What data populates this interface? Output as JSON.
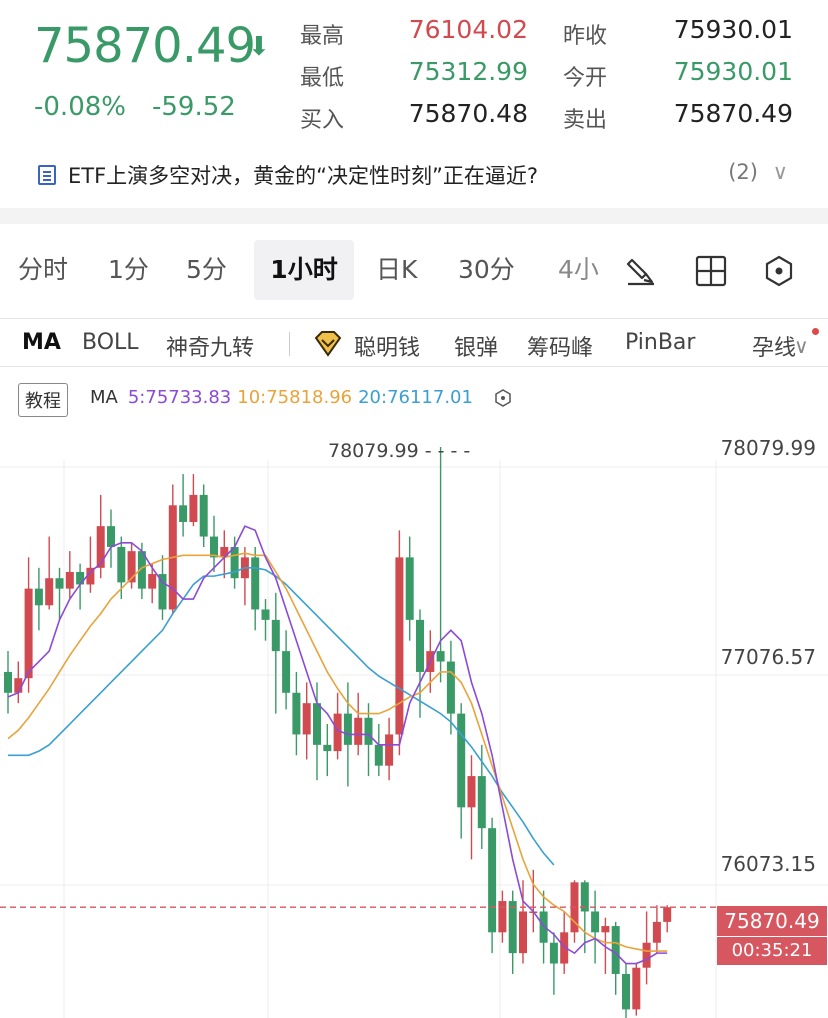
{
  "quote": {
    "price": "75870.49",
    "change_pct": "-0.08%",
    "change": "-59.52",
    "rows": [
      {
        "label": "最高",
        "value": "76104.02",
        "label2": "昨收",
        "value2": "75930.01"
      },
      {
        "label": "最低",
        "value": "75312.99",
        "label2": "今开",
        "value2": "75930.01"
      },
      {
        "label": "买入",
        "value": "75870.48",
        "label2": "卖出",
        "value2": "75870.49"
      }
    ]
  },
  "news": {
    "headline": "ETF上演多空对决，黄金的“决定性时刻”正在逼近?",
    "count": "(2)"
  },
  "timeframes": [
    "分时",
    "1分",
    "5分",
    "1小时",
    "日K",
    "30分",
    "4小"
  ],
  "active_timeframe": "1小时",
  "indicators": [
    "MA",
    "BOLL",
    "神奇九转",
    "聪明钱",
    "银弹",
    "筹码峰",
    "PinBar",
    "孕线"
  ],
  "active_indicator": "MA",
  "chart_header": {
    "tutorial": "教程",
    "ma_label": "MA",
    "ma5": "5:75733.83",
    "ma10": "10:75818.96",
    "ma20": "20:76117.01"
  },
  "colors": {
    "up": "#d04a50",
    "down": "#3a9a67",
    "ma5": "#8a4bd6",
    "ma10": "#e9a33b",
    "ma20": "#3b9fd1"
  },
  "chart_data": {
    "type": "candlestick",
    "price_labels": [
      "78079.99",
      "77076.57",
      "76073.15"
    ],
    "high_marker": "78079.99",
    "current_price": "75870.49",
    "countdown": "00:35:21",
    "candles": [
      [
        77000,
        76900,
        77100,
        76800
      ],
      [
        76900,
        76970,
        77050,
        76850
      ],
      [
        76970,
        77400,
        77550,
        76900
      ],
      [
        77400,
        77320,
        77500,
        77200
      ],
      [
        77320,
        77450,
        77650,
        77300
      ],
      [
        77450,
        77400,
        77500,
        77250
      ],
      [
        77400,
        77480,
        77580,
        77350
      ],
      [
        77480,
        77420,
        77520,
        77300
      ],
      [
        77420,
        77500,
        77650,
        77380
      ],
      [
        77500,
        77700,
        77850,
        77450
      ],
      [
        77700,
        77600,
        77780,
        77500
      ],
      [
        77600,
        77430,
        77650,
        77350
      ],
      [
        77430,
        77580,
        77620,
        77400
      ],
      [
        77580,
        77400,
        77620,
        77350
      ],
      [
        77400,
        77470,
        77520,
        77330
      ],
      [
        77470,
        77300,
        77560,
        77250
      ],
      [
        77300,
        77800,
        77900,
        77280
      ],
      [
        77800,
        77720,
        77950,
        77650
      ],
      [
        77720,
        77850,
        77950,
        77700
      ],
      [
        77850,
        77650,
        77900,
        77600
      ],
      [
        77650,
        77550,
        77750,
        77480
      ],
      [
        77550,
        77600,
        77680,
        77450
      ],
      [
        77600,
        77450,
        77650,
        77400
      ],
      [
        77450,
        77550,
        77600,
        77320
      ],
      [
        77550,
        77300,
        77600,
        77200
      ],
      [
        77300,
        77250,
        77350,
        77150
      ],
      [
        77250,
        77100,
        77380,
        76800
      ],
      [
        77100,
        76900,
        77200,
        76820
      ],
      [
        76900,
        76700,
        77000,
        76600
      ],
      [
        76700,
        76850,
        76950,
        76580
      ],
      [
        76850,
        76650,
        76950,
        76480
      ],
      [
        76650,
        76620,
        76750,
        76500
      ],
      [
        76620,
        76800,
        76900,
        76580
      ],
      [
        76800,
        76650,
        76950,
        76450
      ],
      [
        76650,
        76780,
        76900,
        76600
      ],
      [
        76780,
        76650,
        76850,
        76500
      ],
      [
        76650,
        76550,
        76750,
        76500
      ],
      [
        76550,
        76700,
        76780,
        76480
      ],
      [
        76700,
        77550,
        77680,
        76600
      ],
      [
        77550,
        77250,
        77650,
        77150
      ],
      [
        77250,
        77000,
        77300,
        76780
      ],
      [
        77000,
        77100,
        77200,
        76900
      ],
      [
        77100,
        77050,
        78080,
        76950
      ],
      [
        77050,
        76800,
        77150,
        76700
      ],
      [
        76800,
        76350,
        76850,
        76200
      ],
      [
        76350,
        76500,
        76600,
        76100
      ],
      [
        76500,
        76250,
        76650,
        76150
      ],
      [
        76250,
        75750,
        76300,
        75650
      ],
      [
        75750,
        75900,
        75950,
        75700
      ],
      [
        75900,
        75650,
        75950,
        75550
      ],
      [
        75650,
        75850,
        76000,
        75600
      ],
      [
        75850,
        75850,
        76050,
        75750
      ],
      [
        75850,
        75700,
        75950,
        75600
      ],
      [
        75700,
        75600,
        75750,
        75450
      ],
      [
        75600,
        75750,
        75850,
        75550
      ],
      [
        75750,
        75990,
        76000,
        75700
      ],
      [
        75990,
        75850,
        76000,
        75650
      ],
      [
        75850,
        75750,
        75950,
        75600
      ],
      [
        75750,
        75780,
        75820,
        75550
      ],
      [
        75780,
        75550,
        75800,
        75450
      ],
      [
        75550,
        75380,
        75600,
        75280
      ],
      [
        75380,
        75580,
        75600,
        75350
      ],
      [
        75580,
        75700,
        75850,
        75500
      ],
      [
        75700,
        75800,
        75880,
        75650
      ],
      [
        75800,
        75870,
        75880,
        75750
      ]
    ],
    "ma5": [
      76880,
      76900,
      77000,
      77050,
      77100,
      77250,
      77350,
      77420,
      77480,
      77520,
      77600,
      77620,
      77620,
      77580,
      77500,
      77430,
      77400,
      77350,
      77350,
      77450,
      77500,
      77550,
      77600,
      77700,
      77680,
      77550,
      77450,
      77300,
      77150,
      77000,
      76850,
      76800,
      76720,
      76700,
      76700,
      76700,
      76650,
      76650,
      76650,
      76850,
      76950,
      77050,
      77150,
      77200,
      77150,
      76950,
      76800,
      76600,
      76350,
      76100,
      75900,
      75850,
      75780,
      75740,
      75680,
      75650,
      75700,
      75720,
      75680,
      75650,
      75600,
      75600,
      75620,
      75650,
      75650
    ],
    "ma10": [
      76680,
      76720,
      76780,
      76850,
      76920,
      77000,
      77080,
      77150,
      77220,
      77280,
      77350,
      77400,
      77450,
      77500,
      77520,
      77540,
      77550,
      77560,
      77560,
      77560,
      77560,
      77550,
      77560,
      77570,
      77560,
      77560,
      77480,
      77400,
      77300,
      77200,
      77100,
      77000,
      76920,
      76850,
      76800,
      76800,
      76800,
      76820,
      76850,
      76880,
      76900,
      76950,
      77000,
      77000,
      76950,
      76850,
      76700,
      76550,
      76400,
      76250,
      76100,
      75980,
      75920,
      75880,
      75850,
      75800,
      75750,
      75720,
      75700,
      75700,
      75680,
      75670,
      75660,
      75660,
      75660
    ],
    "ma20": [
      76600,
      76600,
      76600,
      76620,
      76650,
      76700,
      76750,
      76800,
      76850,
      76900,
      76950,
      77000,
      77050,
      77100,
      77150,
      77200,
      77280,
      77350,
      77420,
      77460,
      77460,
      77470,
      77480,
      77500,
      77500,
      77490,
      77460,
      77420,
      77370,
      77320,
      77270,
      77220,
      77170,
      77120,
      77070,
      77020,
      76980,
      76950,
      76920,
      76890,
      76860,
      76830,
      76800,
      76760,
      76700,
      76640,
      76570,
      76500,
      76420,
      76350,
      76280,
      76200,
      76130,
      76073
    ]
  }
}
